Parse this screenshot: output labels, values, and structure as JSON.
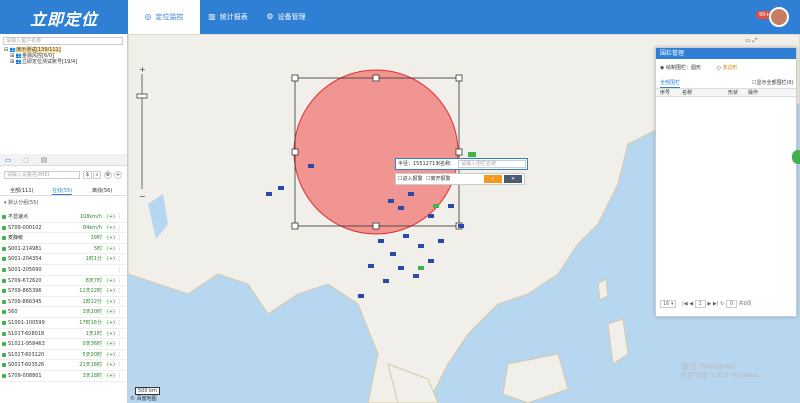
{
  "app": {
    "logo": "立即定位",
    "badge": "99+"
  },
  "nav": [
    {
      "label": "定位监控",
      "icon": "location-icon",
      "active": true
    },
    {
      "label": "统计报表",
      "icon": "chart-icon",
      "active": false
    },
    {
      "label": "设备管理",
      "icon": "gear-icon",
      "active": false
    }
  ],
  "left_top": {
    "search_placeholder": "请输入客户名称",
    "tree": [
      {
        "label": "演示测试[139/111]"
      },
      {
        "label": "金融风控[6/0]"
      },
      {
        "label": "立即定位测试账号[19/4]"
      }
    ]
  },
  "left_bottom": {
    "search_placeholder": "请输入设备名/IMEI",
    "search_button": "$",
    "filters": [
      {
        "label": "全部(111)"
      },
      {
        "label": "在线(55)"
      },
      {
        "label": "离线(56)"
      }
    ],
    "group_label": "默认分组(55)",
    "vehicles": [
      {
        "name": "不显速点",
        "speed": "108km/h",
        "op": "(+)"
      },
      {
        "name": "S709-000102",
        "speed": "84km/h",
        "op": "(+)"
      },
      {
        "name": "麦静敏",
        "speed": "39时",
        "op": "(+)"
      },
      {
        "name": "S001-214981",
        "speed": "5时",
        "op": "(+)"
      },
      {
        "name": "S001-204354",
        "speed": "1时1分",
        "op": "(+)"
      },
      {
        "name": "S001-205690",
        "speed": "",
        "op": ""
      },
      {
        "name": "S709-672620",
        "speed": "8天7时",
        "op": "(+)"
      },
      {
        "name": "S709-865396",
        "speed": "11天22时",
        "op": "(+)"
      },
      {
        "name": "S709-866345",
        "speed": "1时22分",
        "op": "(+)"
      },
      {
        "name": "560",
        "speed": "3天20时",
        "op": "(+)"
      },
      {
        "name": "S1001-100599",
        "speed": "17时16分",
        "op": "(+)"
      },
      {
        "name": "S101T-608018",
        "speed": "1天1时",
        "op": "(+)"
      },
      {
        "name": "S1021-958463",
        "speed": "0天36时",
        "op": "(+)"
      },
      {
        "name": "S101T-603120",
        "speed": "5天20时",
        "op": "(+)"
      },
      {
        "name": "S001T-603526",
        "speed": "21天18时",
        "op": "(+)"
      },
      {
        "name": "S709-008801",
        "speed": "3天18时",
        "op": "(+)"
      }
    ]
  },
  "map": {
    "radius_label": "半径：1551271米",
    "name_label": "名称:",
    "name_placeholder": "请输入围栏名称",
    "enter_alarm": "进入报警",
    "leave_alarm": "离开报警",
    "confirm": "✓",
    "cancel": "✕",
    "scale": "500 km",
    "baidu": "© 百度地图"
  },
  "fence_panel": {
    "title": "围栏管理",
    "radio1": "绘制围栏：圆形",
    "radio2": "多边形",
    "tab": "全部围栏",
    "show_all": "显示全部围栏(0)",
    "columns": [
      "序号",
      "名称",
      "形状",
      "操作"
    ],
    "page_size": "16",
    "page": "1",
    "go": "0",
    "total": "共0页"
  },
  "watermark": {
    "line1": "激活 Windows",
    "line2": "转到\"设置\"以激活 Windows。"
  }
}
